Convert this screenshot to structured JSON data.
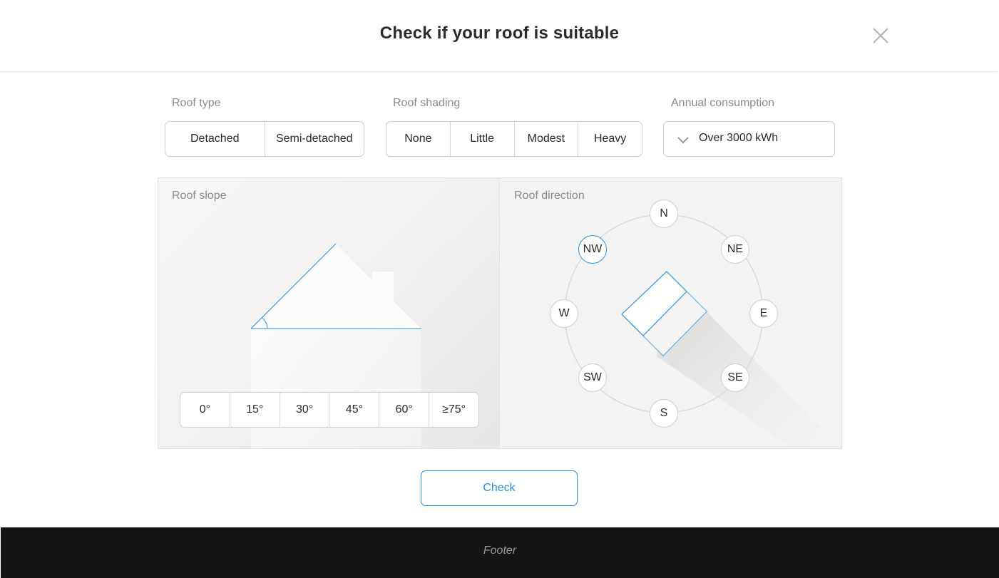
{
  "header": {
    "title": "Check if your roof is suitable",
    "close_icon": "close-icon"
  },
  "roof_type": {
    "label": "Roof type",
    "options": [
      "Detached",
      "Semi-detached"
    ]
  },
  "roof_shading": {
    "label": "Roof shading",
    "options": [
      "None",
      "Little",
      "Modest",
      "Heavy"
    ]
  },
  "annual_consumption": {
    "label": "Annual consumption",
    "value": "Over 3000 kWh",
    "icon": "chevron-down-icon"
  },
  "roof_slope": {
    "label": "Roof slope",
    "options": [
      "0°",
      "15°",
      "30°",
      "45°",
      "60°",
      "≥75°"
    ]
  },
  "roof_direction": {
    "label": "Roof direction",
    "directions": [
      "N",
      "NE",
      "E",
      "SE",
      "S",
      "SW",
      "W",
      "NW"
    ],
    "selected": "NW"
  },
  "check_label": "Check",
  "footer": {
    "text": "Footer"
  },
  "colors": {
    "accent": "#2d8fd6",
    "footer_bg": "#141414"
  }
}
